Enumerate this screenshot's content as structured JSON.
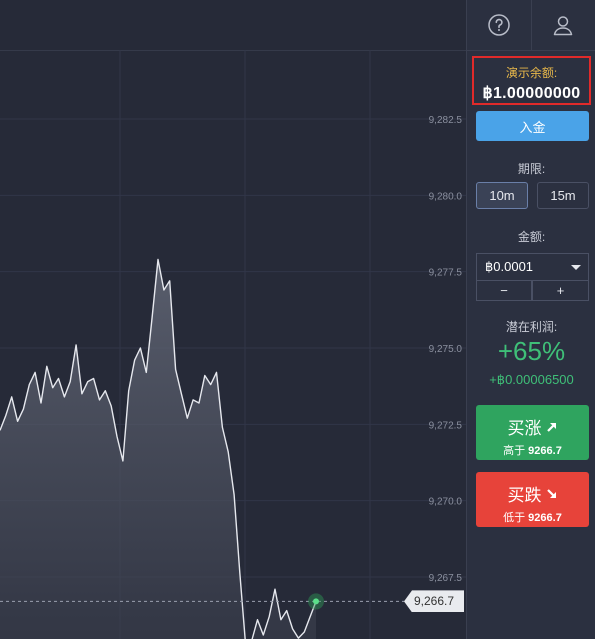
{
  "header": {
    "help_icon": "question-circle-icon",
    "user_icon": "user-icon"
  },
  "balance": {
    "label": "演示余额:",
    "value": "฿1.00000000"
  },
  "deposit": {
    "label": "入金"
  },
  "period": {
    "label": "期限:",
    "options": [
      "10m",
      "15m"
    ],
    "selected": "10m"
  },
  "amount": {
    "label": "金额:",
    "value": "฿0.0001",
    "minus": "−",
    "plus": "+"
  },
  "profit": {
    "label": "潜在利润:",
    "percent": "+65%",
    "amount": "+฿0.00006500"
  },
  "call": {
    "label": "买涨",
    "sub_prefix": "高于",
    "price": "9266.7"
  },
  "put": {
    "label": "买跌",
    "sub_prefix": "低于",
    "price": "9266.7"
  },
  "chart": {
    "current_price": "9,266.7",
    "y_ticks": [
      "9,282.5",
      "9,280.0",
      "9,277.5",
      "9,275.0",
      "9,272.5",
      "9,270.0",
      "9,267.5"
    ]
  },
  "colors": {
    "accent_blue": "#4aa3e8",
    "up_green": "#2fa45f",
    "down_red": "#e7433a",
    "balance_label": "#e8b84a",
    "highlight_border": "#e02a2a"
  },
  "chart_data": {
    "type": "area",
    "ylim": [
      9265.0,
      9283.5
    ],
    "y_ticks": [
      9282.5,
      9280.0,
      9277.5,
      9275.0,
      9272.5,
      9270.0,
      9267.5
    ],
    "current_value": 9266.7,
    "values": [
      9272.3,
      9272.8,
      9273.4,
      9272.6,
      9273.0,
      9273.8,
      9274.2,
      9273.2,
      9274.4,
      9273.7,
      9274.0,
      9273.4,
      9273.9,
      9275.1,
      9273.5,
      9273.9,
      9274.0,
      9273.3,
      9273.6,
      9273.1,
      9272.1,
      9271.3,
      9273.6,
      9274.6,
      9275.0,
      9274.2,
      9276.0,
      9277.9,
      9276.9,
      9277.2,
      9274.3,
      9273.5,
      9272.7,
      9273.3,
      9273.2,
      9274.1,
      9273.8,
      9274.2,
      9272.4,
      9271.6,
      9270.2,
      9267.6,
      9265.2,
      9265.4,
      9266.1,
      9265.6,
      9266.2,
      9267.1,
      9266.1,
      9266.4,
      9265.8,
      9265.5,
      9265.7,
      9266.2,
      9266.7
    ]
  }
}
